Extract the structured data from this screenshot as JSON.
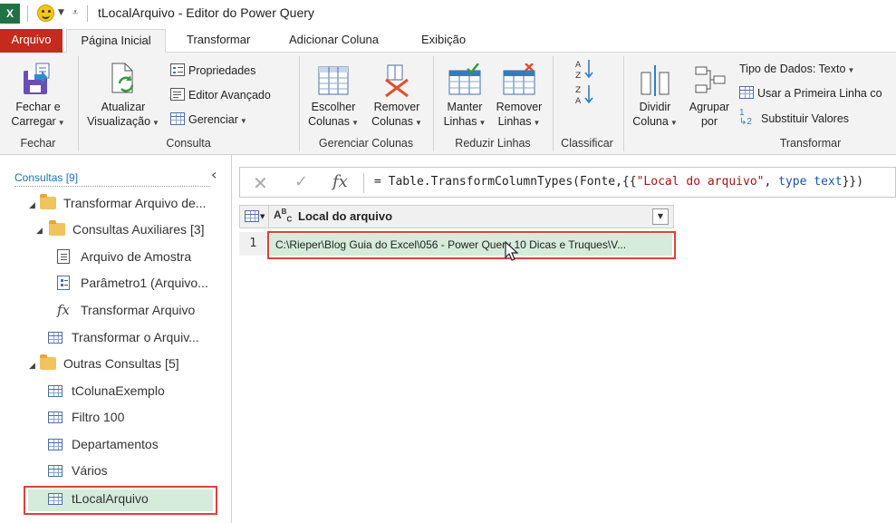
{
  "titlebar": {
    "app_logo": "X",
    "title": "tLocalArquivo - Editor do Power Query",
    "icons": [
      "excel-icon",
      "smiley-icon",
      "quick-access-caret-icon"
    ]
  },
  "tabs": [
    {
      "label": "Arquivo"
    },
    {
      "label": "Página Inicial"
    },
    {
      "label": "Transformar"
    },
    {
      "label": "Adicionar Coluna"
    },
    {
      "label": "Exibição"
    }
  ],
  "ribbon": {
    "fechar": {
      "label": "Fechar",
      "close_load": "Fechar e\nCarregar"
    },
    "consulta": {
      "label": "Consulta",
      "refresh": "Atualizar\nVisualização",
      "properties": "Propriedades",
      "advanced_editor": "Editor Avançado",
      "manage": "Gerenciar"
    },
    "gerenciar_colunas": {
      "label": "Gerenciar Colunas",
      "choose": "Escolher\nColunas",
      "remove": "Remover\nColunas"
    },
    "reduzir_linhas": {
      "label": "Reduzir Linhas",
      "keep": "Manter\nLinhas",
      "remove": "Remover\nLinhas"
    },
    "classificar": {
      "label": "Classificar",
      "sort_az": "A↓Z",
      "sort_za": "Z↓A"
    },
    "transformar": {
      "label": "Transformar",
      "split": "Dividir\nColuna",
      "group": "Agrupar\npor",
      "data_type": "Tipo de Dados: Texto",
      "first_row": "Usar a Primeira Linha co",
      "replace": "Substituir Valores"
    }
  },
  "leftpane": {
    "header": "Consultas [9]",
    "items": [
      {
        "label": "Transformar Arquivo de...",
        "type": "folder"
      },
      {
        "label": "Consultas Auxiliares [3]",
        "type": "folder"
      },
      {
        "label": "Arquivo de Amostra",
        "type": "doc"
      },
      {
        "label": "Parâmetro1 (Arquivo...",
        "type": "param"
      },
      {
        "label": "Transformar Arquivo",
        "type": "fx"
      },
      {
        "label": "Transformar o Arquiv...",
        "type": "table"
      },
      {
        "label": "Outras Consultas [5]",
        "type": "folder"
      },
      {
        "label": "tColunaExemplo",
        "type": "table"
      },
      {
        "label": "Filtro 100",
        "type": "table"
      },
      {
        "label": "Departamentos",
        "type": "table"
      },
      {
        "label": "Vários",
        "type": "table"
      },
      {
        "label": "tLocalArquivo",
        "type": "table"
      }
    ]
  },
  "formulabar": {
    "formula_prefix": "= Table.TransformColumnTypes(Fonte,{{",
    "formula_string": "\"Local do arquivo\"",
    "formula_mid": ", ",
    "formula_keyword": "type text",
    "formula_suffix": "}})"
  },
  "grid": {
    "column_type": "ABC",
    "column_name": "Local do arquivo",
    "rows": [
      {
        "num": "1",
        "value": "C:\\Rieper\\Blog Guia do Excel\\056 - Power Query 10 Dicas e Truques\\V..."
      }
    ]
  }
}
